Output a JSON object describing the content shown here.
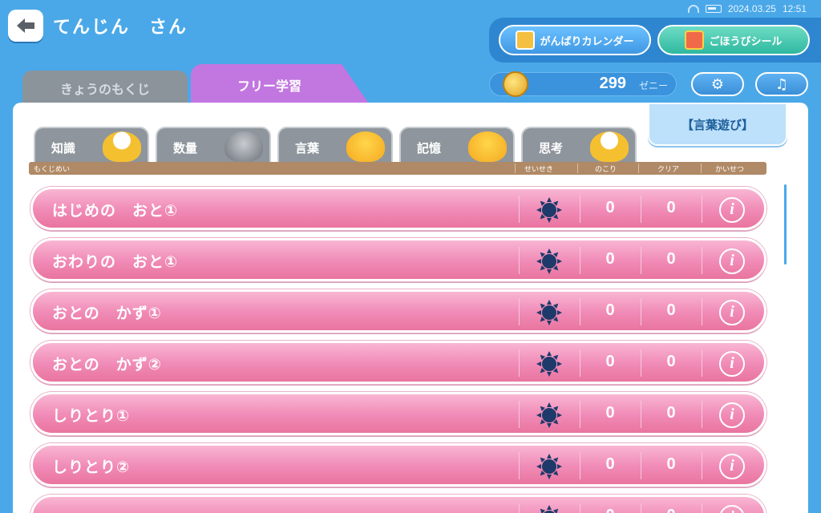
{
  "status": {
    "date": "2024.03.25",
    "time": "12:51"
  },
  "header": {
    "user_name": "てんじん　さん"
  },
  "buttons": {
    "calendar": "がんばりカレンダー",
    "sticker": "ごほうびシール"
  },
  "tabs": {
    "today": "きょうのもくじ",
    "free": "フリー学習"
  },
  "coins": {
    "value": "299",
    "unit": "ゼニー"
  },
  "category": "【言葉遊び】",
  "subtabs": [
    "知識",
    "数量",
    "言葉",
    "記憶",
    "思考"
  ],
  "columns": {
    "title": "もくじめい",
    "result": "せいせき",
    "remaining": "のこり",
    "clear": "クリア",
    "explain": "かいせつ"
  },
  "rows": [
    {
      "title": "はじめの　おと①",
      "remaining": "0",
      "clear": "0"
    },
    {
      "title": "おわりの　おと①",
      "remaining": "0",
      "clear": "0"
    },
    {
      "title": "おとの　かず①",
      "remaining": "0",
      "clear": "0"
    },
    {
      "title": "おとの　かず②",
      "remaining": "0",
      "clear": "0"
    },
    {
      "title": "しりとり①",
      "remaining": "0",
      "clear": "0"
    },
    {
      "title": "しりとり②",
      "remaining": "0",
      "clear": "0"
    },
    {
      "title": "",
      "remaining": "0",
      "clear": "0"
    }
  ],
  "info_symbol": "i",
  "colors": {
    "background": "#4aa8e8",
    "row_pink": "#f08ab6",
    "active_tab": "#c276e0"
  }
}
